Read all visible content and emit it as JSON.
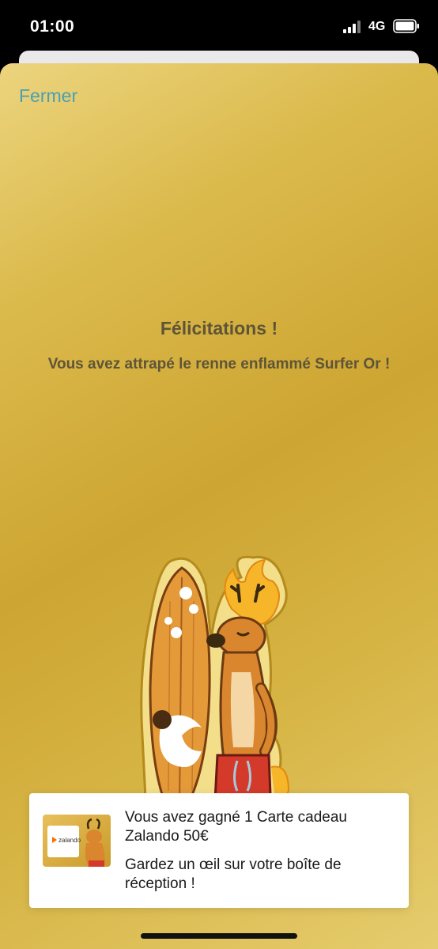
{
  "status_bar": {
    "time": "01:00",
    "network": "4G",
    "signal_icon": "signal-bars-icon",
    "battery_icon": "battery-icon"
  },
  "modal": {
    "close_label": "Fermer",
    "title": "Félicitations !",
    "message": "Vous avez attrapé le renne enflammé Surfer Or !",
    "mascot_icon": "surfer-reindeer-mascot"
  },
  "reward": {
    "title": "Vous avez gagné 1 Carte cadeau Zalando 50€",
    "subtitle": "Gardez un œil sur votre boîte de réception !",
    "card_brand": "zalando"
  },
  "colors": {
    "gold": "#cda532",
    "link": "#4a9fb5",
    "text_dark": "#5e5438",
    "brand_orange": "#ff6900"
  }
}
